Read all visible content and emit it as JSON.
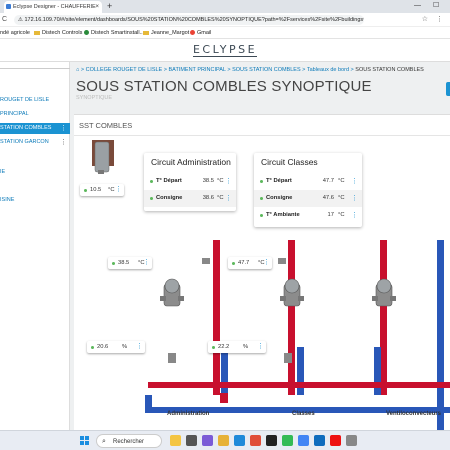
{
  "browser": {
    "tab_title": "Eclypse Designer - CHAUFFERIE",
    "tab_close": "×",
    "new_tab": "+",
    "minimize": "—",
    "maximize": "☐",
    "nav_back": "←",
    "nav_reload": "C",
    "url": "⚠ 172.16.109.70/#/site/element/dashboards/SOUS%20STATION%20COMBLES%20SYNOPTIQUE?path=%2Fservices%2Fsite%2Fbuildings%2FBA...",
    "address_icons": "☆ ⋮",
    "bookmarks": [
      "ndé agricole",
      "Distech Controls",
      "Distech Smartinstall...",
      "Jeanne_Margot",
      "Gmail"
    ]
  },
  "app": {
    "logo": "ECLYPSE"
  },
  "sidebar": {
    "items": [
      {
        "label": "ROUGET DE LISLE"
      },
      {
        "label": "PRINCIPAL"
      },
      {
        "label": "STATION COMBLES"
      },
      {
        "label": "STATION GARCON"
      },
      {
        "label": "IE"
      },
      {
        "label": "ISINE"
      }
    ],
    "kebab": "⋮"
  },
  "breadcrumb": {
    "home": "⌂",
    "items": [
      "COLLEGE ROUGET DE LISLE",
      "BATIMENT PRINCIPAL",
      "SOUS STATION COMBLES",
      "Tableaux de bord",
      "SOUS STATION COMBLES"
    ],
    "sep": ">"
  },
  "page": {
    "title": "SOUS STATION COMBLES SYNOPTIQUE",
    "subtitle": "SYNOPTIQUE"
  },
  "panel": {
    "title": "SST COMBLES"
  },
  "outdoor": {
    "value": "10.5",
    "unit": "°C"
  },
  "circuit_admin": {
    "title": "Circuit Administration",
    "rows": [
      {
        "label": "T° Départ",
        "value": "38.5",
        "unit": "°C"
      },
      {
        "label": "Consigne",
        "value": "38.6",
        "unit": "°C"
      }
    ]
  },
  "circuit_classes": {
    "title": "Circuit Classes",
    "rows": [
      {
        "label": "T° Départ",
        "value": "47.7",
        "unit": "°C"
      },
      {
        "label": "Consigne",
        "value": "47.6",
        "unit": "°C"
      },
      {
        "label": "T° Ambiante",
        "value": "17",
        "unit": "°C"
      }
    ]
  },
  "chips": {
    "admin_temp": {
      "value": "38.5",
      "unit": "°C"
    },
    "classes_temp": {
      "value": "47.7",
      "unit": "°C"
    },
    "admin_valve": {
      "value": "20.6",
      "unit": "%"
    },
    "classes_valve": {
      "value": "22.2",
      "unit": "%"
    }
  },
  "circuits": [
    "Administration",
    "Classes",
    "Ventiloconvecteurs"
  ],
  "taskbar": {
    "search": "Rechercher"
  },
  "colors": {
    "accent": "#1b93d2",
    "supply_pipe": "#c8102e",
    "return_pipe": "#2957b8",
    "status_ok": "#5cb85c"
  }
}
